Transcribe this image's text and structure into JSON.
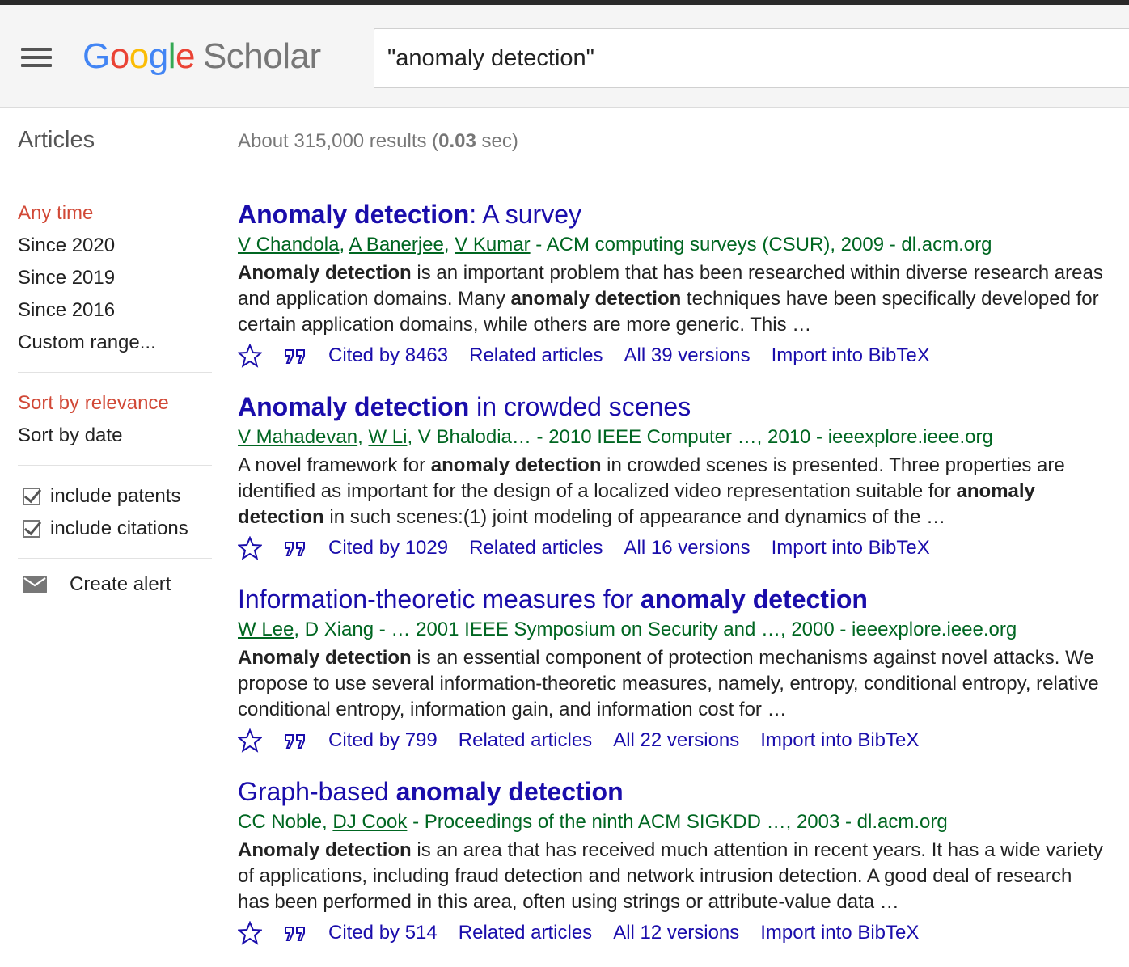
{
  "header": {
    "logo": {
      "g1": "G",
      "o1": "o",
      "o2": "o",
      "g2": "g",
      "l": "l",
      "e": "e",
      "scholar": "Scholar"
    },
    "search_value": "\"anomaly detection\""
  },
  "subbar": {
    "section_label": "Articles",
    "results_prefix": "About 315,000 results (",
    "results_time": "0.03",
    "results_suffix": " sec)"
  },
  "sidebar": {
    "time_filters": [
      "Any time",
      "Since 2020",
      "Since 2019",
      "Since 2016",
      "Custom range..."
    ],
    "sort_options": [
      "Sort by relevance",
      "Sort by date"
    ],
    "checks": [
      "include patents",
      "include citations"
    ],
    "create_alert": "Create alert"
  },
  "colors": {
    "link": "#1a0dab",
    "meta_green": "#006621",
    "active_red": "#d14836",
    "header_bg": "#f5f5f5"
  },
  "results": [
    {
      "title": [
        {
          "t": "Anomaly detection",
          "b": true
        },
        {
          "t": ": A survey",
          "b": false
        }
      ],
      "meta": [
        {
          "t": "V Chandola",
          "u": true
        },
        {
          "t": ", ",
          "u": false
        },
        {
          "t": "A Banerjee",
          "u": true
        },
        {
          "t": ", ",
          "u": false
        },
        {
          "t": "V Kumar",
          "u": true
        },
        {
          "t": " - ACM computing surveys (CSUR), 2009 - dl.acm.org",
          "u": false
        }
      ],
      "snippet": [
        {
          "t": "Anomaly detection",
          "b": true
        },
        {
          "t": " is an important problem that has been researched within diverse research areas and application domains. Many ",
          "b": false
        },
        {
          "t": "anomaly detection",
          "b": true
        },
        {
          "t": " techniques have been specifically developed for certain application domains, while others are more generic. This …",
          "b": false
        }
      ],
      "cited": "Cited by 8463",
      "related": "Related articles",
      "versions": "All 39 versions",
      "bibtex": "Import into BibTeX"
    },
    {
      "title": [
        {
          "t": "Anomaly detection",
          "b": true
        },
        {
          "t": " in crowded scenes",
          "b": false
        }
      ],
      "meta": [
        {
          "t": "V Mahadevan",
          "u": true
        },
        {
          "t": ", ",
          "u": false
        },
        {
          "t": "W Li",
          "u": true
        },
        {
          "t": ", V Bhalodia… - 2010 IEEE Computer …, 2010 - ieeexplore.ieee.org",
          "u": false
        }
      ],
      "snippet": [
        {
          "t": "A novel framework for ",
          "b": false
        },
        {
          "t": "anomaly detection",
          "b": true
        },
        {
          "t": " in crowded scenes is presented. Three properties are identified as important for the design of a localized video representation suitable for ",
          "b": false
        },
        {
          "t": "anomaly detection",
          "b": true
        },
        {
          "t": " in such scenes:(1) joint modeling of appearance and dynamics of the …",
          "b": false
        }
      ],
      "cited": "Cited by 1029",
      "related": "Related articles",
      "versions": "All 16 versions",
      "bibtex": "Import into BibTeX"
    },
    {
      "title": [
        {
          "t": "Information-theoretic measures for ",
          "b": false
        },
        {
          "t": "anomaly detection",
          "b": true
        }
      ],
      "meta": [
        {
          "t": "W Lee",
          "u": true
        },
        {
          "t": ", D Xiang - … 2001 IEEE Symposium on Security and …, 2000 - ieeexplore.ieee.org",
          "u": false
        }
      ],
      "snippet": [
        {
          "t": "Anomaly detection",
          "b": true
        },
        {
          "t": " is an essential component of protection mechanisms against novel attacks. We propose to use several information-theoretic measures, namely, entropy, conditional entropy, relative conditional entropy, information gain, and information cost for …",
          "b": false
        }
      ],
      "cited": "Cited by 799",
      "related": "Related articles",
      "versions": "All 22 versions",
      "bibtex": "Import into BibTeX"
    },
    {
      "title": [
        {
          "t": "Graph-based ",
          "b": false
        },
        {
          "t": "anomaly detection",
          "b": true
        }
      ],
      "meta": [
        {
          "t": "CC Noble, ",
          "u": false
        },
        {
          "t": "DJ Cook",
          "u": true
        },
        {
          "t": " - Proceedings of the ninth ACM SIGKDD …, 2003 - dl.acm.org",
          "u": false
        }
      ],
      "snippet": [
        {
          "t": "Anomaly detection",
          "b": true
        },
        {
          "t": " is an area that has received much attention in recent years. It has a wide variety of applications, including fraud detection and network intrusion detection. A good deal of research has been performed in this area, often using strings or attribute-value data …",
          "b": false
        }
      ],
      "cited": "Cited by 514",
      "related": "Related articles",
      "versions": "All 12 versions",
      "bibtex": "Import into BibTeX"
    }
  ],
  "icons": {
    "star": "star-icon",
    "cite": "cite-quote-icon",
    "mail": "mail-icon",
    "menu": "menu-icon"
  }
}
